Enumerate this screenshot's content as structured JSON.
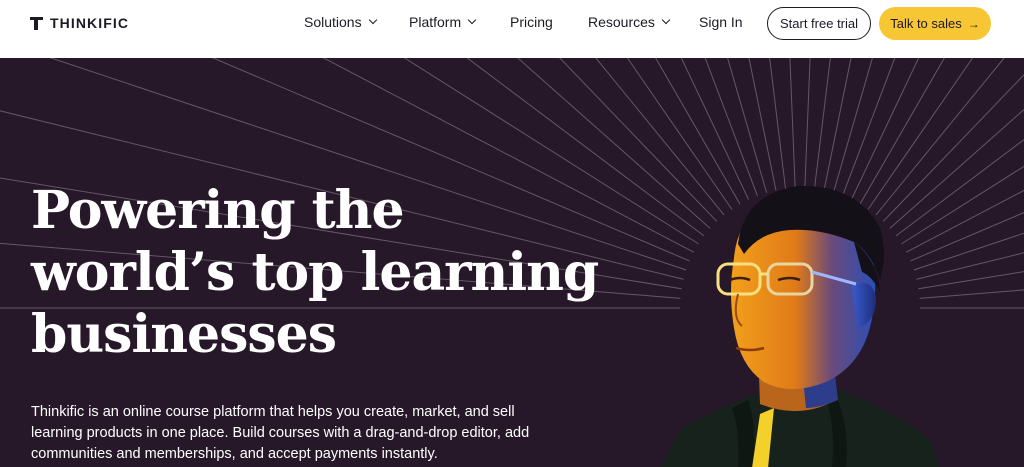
{
  "brand": {
    "name": "THINKIFIC"
  },
  "nav": {
    "items": [
      {
        "label": "Solutions",
        "has_dropdown": true
      },
      {
        "label": "Platform",
        "has_dropdown": true
      },
      {
        "label": "Pricing",
        "has_dropdown": false
      },
      {
        "label": "Resources",
        "has_dropdown": true
      },
      {
        "label": "Sign In",
        "has_dropdown": false
      }
    ],
    "cta_secondary": "Start free trial",
    "cta_primary": "Talk to sales",
    "cta_primary_icon": "arrow-right-icon"
  },
  "hero": {
    "headline_lines": [
      "Powering the",
      "world’s top learning",
      "businesses"
    ],
    "subtext_lines": [
      "Thinkific is an online course platform that helps you create, market, and sell",
      "learning products in one place. Build courses with a drag-and-drop editor, add",
      "communities and memberships, and accept payments instantly."
    ]
  },
  "colors": {
    "hero_bg": "#271829",
    "accent": "#f7c634",
    "text_dark": "#1e1a24",
    "text_light": "#ffffff"
  }
}
